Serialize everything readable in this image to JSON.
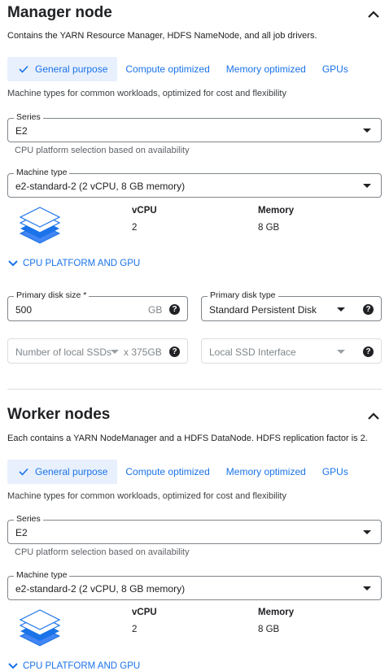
{
  "manager": {
    "title": "Manager node",
    "description": "Contains the YARN Resource Manager, HDFS NameNode, and all job drivers.",
    "tabs": [
      "General purpose",
      "Compute optimized",
      "Memory optimized",
      "GPUs"
    ],
    "tab_hint": "Machine types for common workloads, optimized for cost and flexibility",
    "series_label": "Series",
    "series_value": "E2",
    "series_hint": "CPU platform selection based on availability",
    "machine_label": "Machine type",
    "machine_value": "e2-standard-2 (2 vCPU, 8 GB memory)",
    "vcpu_label": "vCPU",
    "vcpu_value": "2",
    "memory_label": "Memory",
    "memory_value": "8 GB",
    "expander": "CPU PLATFORM AND GPU",
    "disk_size_label": "Primary disk size *",
    "disk_size_value": "500",
    "disk_size_unit": "GB",
    "disk_type_label": "Primary disk type",
    "disk_type_value": "Standard Persistent Disk",
    "local_ssd_placeholder": "Number of local SSDs",
    "local_ssd_unit": "x 375GB",
    "ssd_interface_placeholder": "Local SSD Interface"
  },
  "worker": {
    "title": "Worker nodes",
    "description": "Each contains a YARN NodeManager and a HDFS DataNode. HDFS replication factor is 2.",
    "tabs": [
      "General purpose",
      "Compute optimized",
      "Memory optimized",
      "GPUs"
    ],
    "tab_hint": "Machine types for common workloads, optimized for cost and flexibility",
    "series_label": "Series",
    "series_value": "E2",
    "series_hint": "CPU platform selection based on availability",
    "machine_label": "Machine type",
    "machine_value": "e2-standard-2 (2 vCPU, 8 GB memory)",
    "vcpu_label": "vCPU",
    "vcpu_value": "2",
    "memory_label": "Memory",
    "memory_value": "8 GB",
    "expander": "CPU PLATFORM AND GPU"
  },
  "help_glyph": "?",
  "colors": {
    "accent": "#1a73e8",
    "tab_active_bg": "#e8f0fe",
    "text": "#202124",
    "muted": "#5f6368"
  }
}
